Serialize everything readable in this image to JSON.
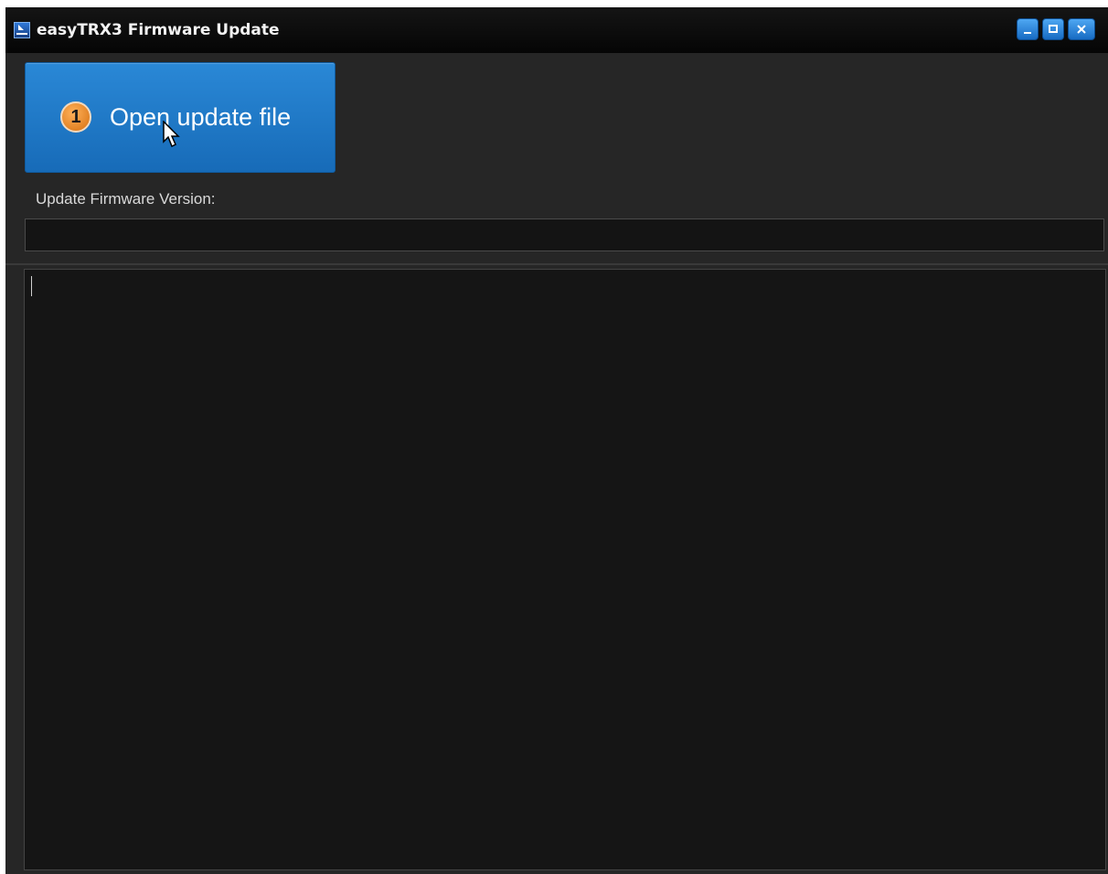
{
  "window": {
    "title": "easyTRX3 Firmware Update",
    "controls": {
      "minimize_icon": "minimize-icon",
      "maximize_icon": "maximize-icon",
      "close_icon": "close-icon"
    }
  },
  "main": {
    "open_button": {
      "step_number": "1",
      "label": "Open update file"
    },
    "firmware_version": {
      "label": "Update Firmware Version:",
      "value": ""
    },
    "log": {
      "text": ""
    }
  },
  "colors": {
    "button_blue": "#2a88d6",
    "badge_orange": "#e8892c",
    "background": "#262626",
    "field_background": "#141414"
  }
}
